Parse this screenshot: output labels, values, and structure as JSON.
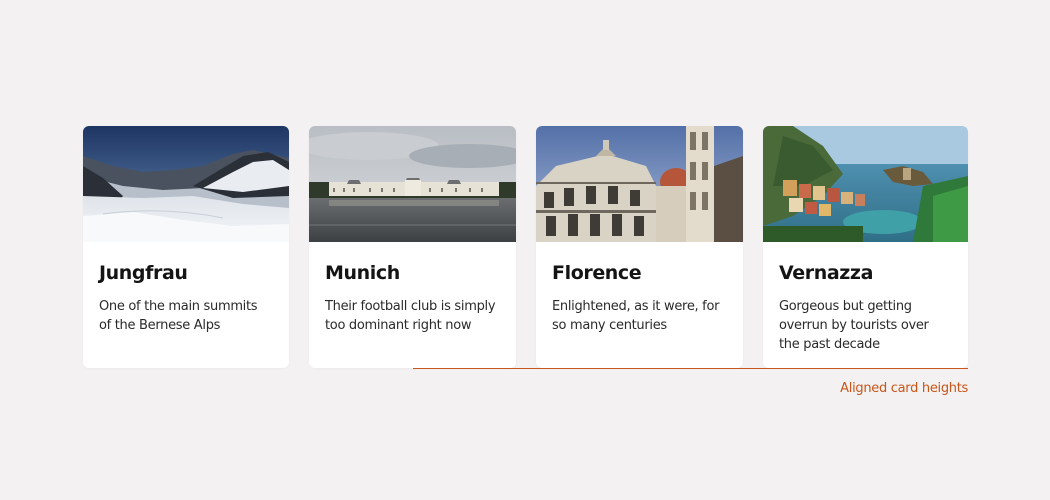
{
  "cards": [
    {
      "title": "Jungfrau",
      "text": "One of the main summits of the Bernese Alps",
      "image": "snowy-alpine-glacier-photo"
    },
    {
      "title": "Munich",
      "text": "Their football club is simply too dominant right now",
      "image": "palace-lake-cloudy-photo"
    },
    {
      "title": "Florence",
      "text": "Enlightened, as it were, for so many centuries",
      "image": "cathedral-baptistery-photo"
    },
    {
      "title": "Vernazza",
      "text": "Gorgeous but getting overrun by tourists over the past decade",
      "image": "coastal-village-harbor-photo"
    }
  ],
  "annotation": {
    "label": "Aligned card heights",
    "color": "#c8561b"
  }
}
